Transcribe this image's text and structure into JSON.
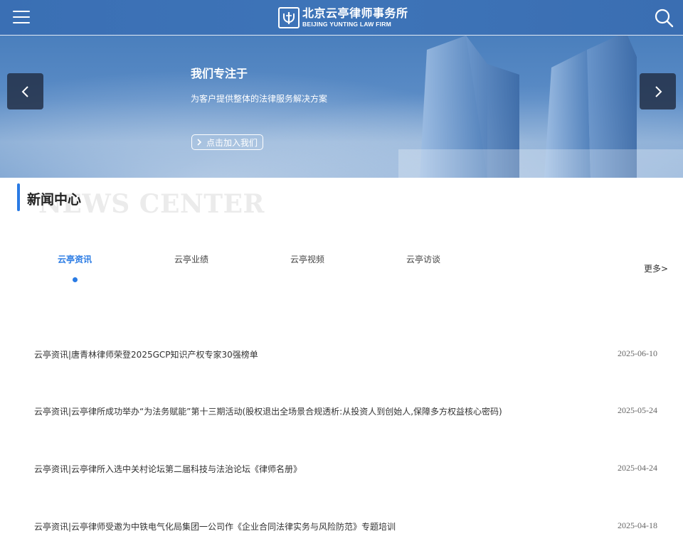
{
  "header": {
    "logo_cn": "北京云亭律师事务所",
    "logo_en": "BEIJING YUNTING LAW FIRM"
  },
  "banner": {
    "title": "我们专注于",
    "subtitle": "为客户提供整体的法律服务解决方案",
    "join_label": "点击加入我们"
  },
  "section": {
    "title_cn": "新闻中心",
    "title_en": "NEWS CENTER"
  },
  "tabs": [
    {
      "label": "云亭资讯",
      "active": true
    },
    {
      "label": "云亭业绩",
      "active": false
    },
    {
      "label": "云亭视频",
      "active": false
    },
    {
      "label": "云亭访谈",
      "active": false
    }
  ],
  "more_label": "更多>",
  "news": [
    {
      "title": "云亭资讯|唐青林律师荣登2025GCP知识产权专家30强榜单",
      "date": "2025-06-10"
    },
    {
      "title": "云亭资讯|云亭律所成功举办“为法务赋能”第十三期活动(股权退出全场景合规透析:从投资人到创始人,保障多方权益核心密码)",
      "date": "2025-05-24"
    },
    {
      "title": "云亭资讯|云亭律所入选中关村论坛第二届科技与法治论坛《律师名册》",
      "date": "2025-04-24"
    },
    {
      "title": "云亭资讯|云亭律师受邀为中铁电气化局集团一公司作《企业合同法律实务与风险防范》专题培训",
      "date": "2025-04-18"
    }
  ],
  "colors": {
    "accent": "#2a7be4",
    "header_bg": "#3c72b6"
  }
}
